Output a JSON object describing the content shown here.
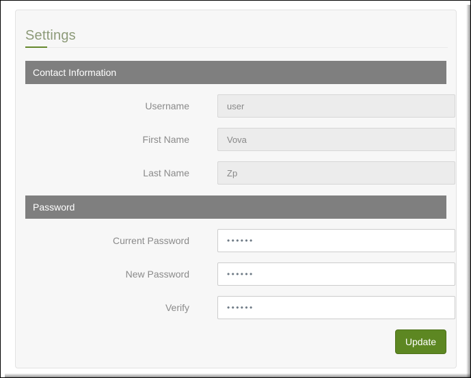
{
  "page": {
    "title": "Settings",
    "accent_color": "#63872a",
    "title_color": "#8c9a78",
    "panel_background": "#f7f7f7",
    "section_bar_color": "#7f7f7f"
  },
  "sections": [
    {
      "heading": "Contact Information",
      "fields": [
        {
          "label": "Username",
          "value": "user",
          "type": "text",
          "disabled": true
        },
        {
          "label": "First Name",
          "value": "Vova",
          "type": "text",
          "disabled": true
        },
        {
          "label": "Last Name",
          "value": "Zp",
          "type": "text",
          "disabled": true
        }
      ]
    },
    {
      "heading": "Password",
      "fields": [
        {
          "label": "Current Password",
          "value": "••••••",
          "type": "password",
          "disabled": false
        },
        {
          "label": "New Password",
          "value": "••••••",
          "type": "password",
          "disabled": false
        },
        {
          "label": "Verify",
          "value": "••••••",
          "type": "password",
          "disabled": false
        }
      ]
    }
  ],
  "actions": {
    "update_label": "Update",
    "update_color": "#5d8722"
  }
}
